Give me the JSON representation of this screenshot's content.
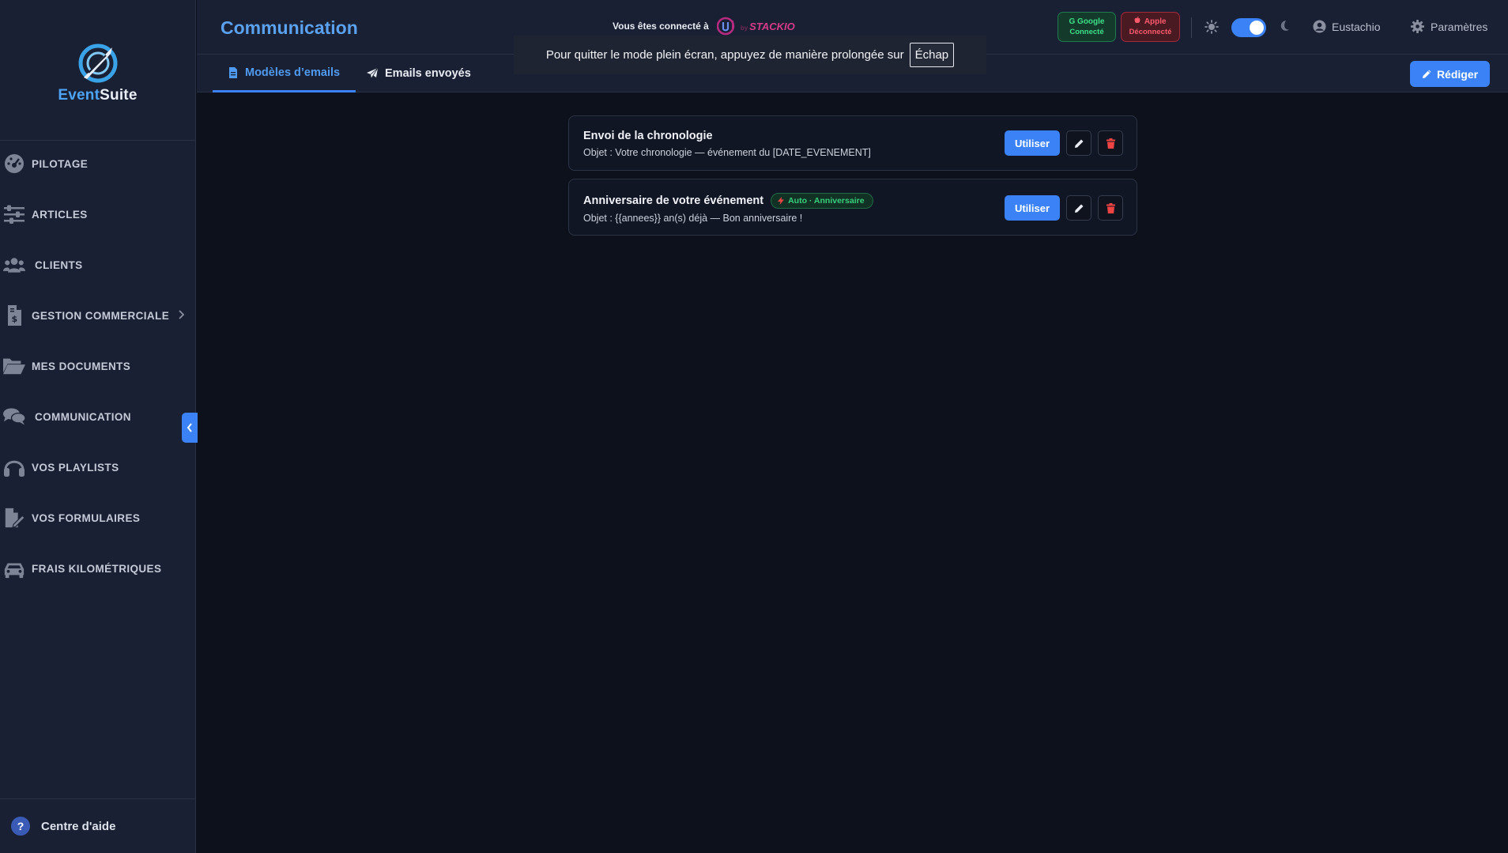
{
  "brand": {
    "name_part1": "Event",
    "name_part2": "Suite"
  },
  "sidebar": {
    "items": [
      {
        "label": "PILOTAGE",
        "icon": "dashboard-icon"
      },
      {
        "label": "ARTICLES",
        "icon": "sliders-icon"
      },
      {
        "label": "CLIENTS",
        "icon": "users-icon"
      },
      {
        "label": "GESTION COMMERCIALE",
        "icon": "invoice-icon",
        "has_submenu": true
      },
      {
        "label": "MES DOCUMENTS",
        "icon": "folder-icon"
      },
      {
        "label": "COMMUNICATION",
        "icon": "chat-icon"
      },
      {
        "label": "VOS PLAYLISTS",
        "icon": "headphones-icon"
      },
      {
        "label": "VOS FORMULAIRES",
        "icon": "form-icon"
      },
      {
        "label": "FRAIS KILOMÉTRIQUES",
        "icon": "car-icon"
      }
    ],
    "help_label": "Centre d'aide"
  },
  "header": {
    "title": "Communication",
    "connected_label": "Vous êtes connecté à",
    "partner_brand": "STACKIO",
    "partner_prefix": "by",
    "google": {
      "label": "Google",
      "status": "Connecté",
      "color": "#3ee088"
    },
    "apple": {
      "label": "Apple",
      "status": "Déconnecté",
      "color": "#ff5a6c"
    },
    "theme_toggle_on": true,
    "user_name": "Eustachio",
    "settings_label": "Paramètres"
  },
  "tabs": [
    {
      "label": "Modèles d’emails",
      "icon": "document-icon",
      "active": true
    },
    {
      "label": "Emails envoyés",
      "icon": "paper-plane-icon",
      "active": false
    }
  ],
  "compose_label": "Rédiger",
  "fullscreen_toast": {
    "message": "Pour quitter le mode plein écran, appuyez de manière prolongée sur",
    "key": "Échap"
  },
  "templates": [
    {
      "title": "Envoi de la chronologie",
      "subject": "Objet : Votre chronologie — événement du [DATE_EVENEMENT]",
      "badge": null
    },
    {
      "title": "Anniversaire de votre événement",
      "subject": "Objet : {{annees}} an(s) déjà — Bon anniversaire !",
      "badge": "Auto · Anniversaire"
    }
  ],
  "actions": {
    "use_label": "Utiliser"
  },
  "colors": {
    "accent": "#3b82f6",
    "danger": "#ef4444",
    "success": "#39d07d"
  }
}
